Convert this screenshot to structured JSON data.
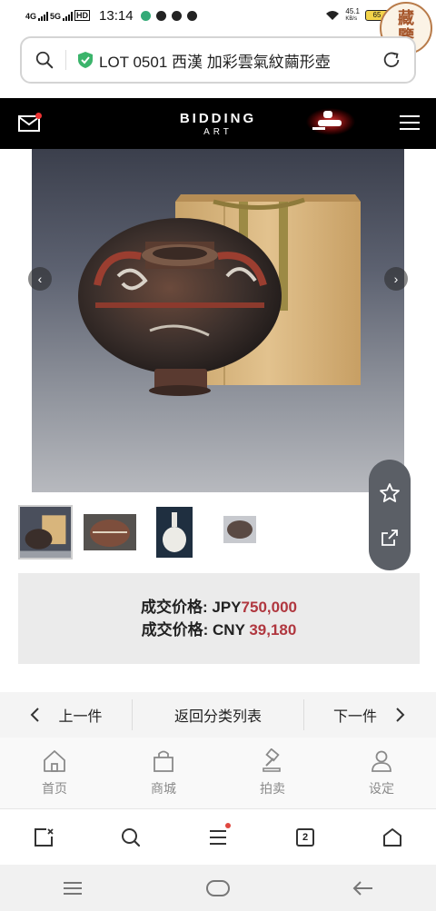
{
  "status_bar": {
    "network_1": "4G",
    "network_2": "5G",
    "hd_badge": "HD",
    "time": "13:14",
    "speed_value": "45.1",
    "speed_unit": "KB/s",
    "battery": "65"
  },
  "seal": {
    "line1": "藏",
    "line2": "鑒"
  },
  "address_bar": {
    "url_text": "LOT 0501 西漢 加彩雲氣紋繭形壺"
  },
  "site_header": {
    "logo_line1": "BIDDING",
    "logo_line2": "ART"
  },
  "gallery": {
    "thumbnail_count": 4,
    "active_index": 0
  },
  "price": {
    "jpy_label": "成交价格: JPY",
    "jpy_value": "750,000",
    "cny_label": "成交价格: CNY ",
    "cny_value": "39,180",
    "value_color": "#b0373f"
  },
  "page_nav": {
    "prev_label": "上一件",
    "back_label": "返回分类列表",
    "next_label": "下一件"
  },
  "site_tabs": [
    {
      "label": "首页",
      "icon": "home-icon"
    },
    {
      "label": "商城",
      "icon": "shopping-bag-icon"
    },
    {
      "label": "拍卖",
      "icon": "gavel-icon"
    },
    {
      "label": "设定",
      "icon": "user-icon"
    }
  ],
  "browser_toolbar": {
    "tab_count": "2"
  }
}
